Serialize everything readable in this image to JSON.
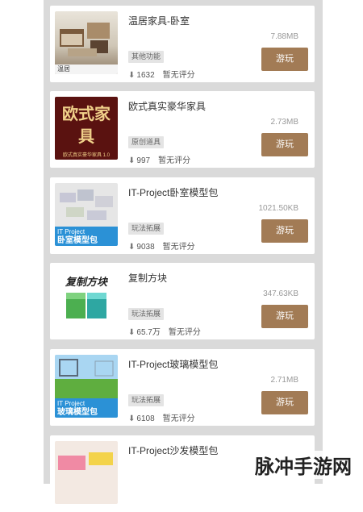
{
  "items": [
    {
      "title": "温居家具-卧室",
      "size": "7.88MB",
      "tag": "其他功能",
      "downloads": "1632",
      "rating": "暂无评分",
      "thumb_caption": "温居"
    },
    {
      "title": "欧式真实豪华家具",
      "size": "2.73MB",
      "tag": "原创道具",
      "downloads": "997",
      "rating": "暂无评分",
      "thumb_text": "欧式家具",
      "thumb_sub": "欧式真实豪华家具 1.0"
    },
    {
      "title": "IT-Project卧室模型包",
      "size": "1021.50KB",
      "tag": "玩法拓展",
      "downloads": "9038",
      "rating": "暂无评分",
      "thumb_brand": "IT Project",
      "thumb_text": "卧室模型包"
    },
    {
      "title": "复制方块",
      "size": "347.63KB",
      "tag": "玩法拓展",
      "downloads": "65.7万",
      "rating": "暂无评分",
      "thumb_text": "复制方块"
    },
    {
      "title": "IT-Project玻璃模型包",
      "size": "2.71MB",
      "tag": "玩法拓展",
      "downloads": "6108",
      "rating": "暂无评分",
      "thumb_brand": "IT Project",
      "thumb_text": "玻璃模型包"
    },
    {
      "title": "IT-Project沙发模型包",
      "size": "",
      "tag": "",
      "downloads": "",
      "rating": ""
    }
  ],
  "play_label": "游玩",
  "download_icon": "download-arrow-icon",
  "watermark": "脉冲手游网",
  "colors": {
    "play_button": "#a27b55",
    "panel": "#dadada"
  }
}
